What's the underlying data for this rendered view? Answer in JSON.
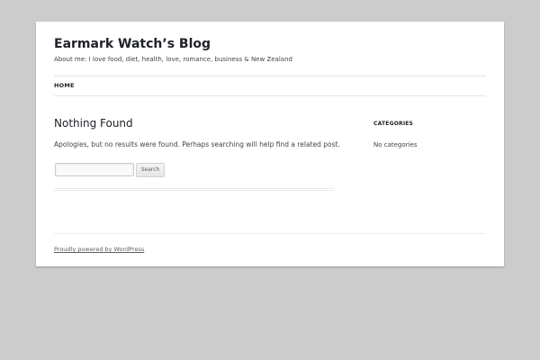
{
  "header": {
    "site_title": "Earmark Watch’s Blog",
    "site_description": "About me: I love food, diet, health, love, romance, business & New Zealand"
  },
  "nav": {
    "items": [
      {
        "label": "HOME"
      }
    ]
  },
  "main": {
    "title": "Nothing Found",
    "message": "Apologies, but no results were found. Perhaps searching will help find a related post.",
    "search": {
      "value": "",
      "placeholder": "",
      "button_label": "Search"
    }
  },
  "sidebar": {
    "widget_title": "CATEGORIES",
    "widget_items": [
      "No categories"
    ]
  },
  "footer": {
    "credit_link": "Proudly powered by WordPress"
  },
  "colors": {
    "background": "#cccccc",
    "page": "#ffffff",
    "heading": "#21232a",
    "text": "#444444"
  }
}
